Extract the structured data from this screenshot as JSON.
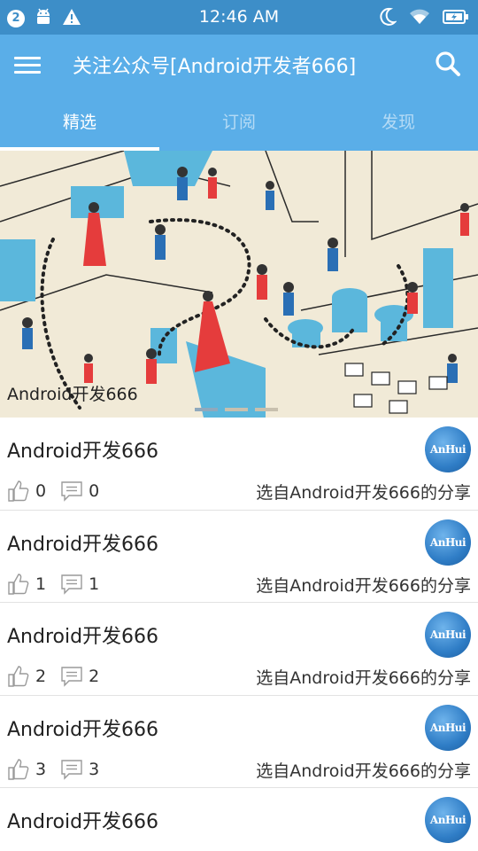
{
  "status_bar": {
    "badge": "2",
    "time": "12:46 AM"
  },
  "app_bar": {
    "title": "关注公众号[Android开发者666]"
  },
  "tabs": [
    {
      "label": "精选",
      "active": true
    },
    {
      "label": "订阅",
      "active": false
    },
    {
      "label": "发现",
      "active": false
    }
  ],
  "banner": {
    "caption": "Android开发666",
    "page_count": 3,
    "current_page": 1
  },
  "list": [
    {
      "title": "Android开发666",
      "avatar_text": "AnHui",
      "likes": "0",
      "comments": "0",
      "source": "选自Android开发666的分享"
    },
    {
      "title": "Android开发666",
      "avatar_text": "AnHui",
      "likes": "1",
      "comments": "1",
      "source": "选自Android开发666的分享"
    },
    {
      "title": "Android开发666",
      "avatar_text": "AnHui",
      "likes": "2",
      "comments": "2",
      "source": "选自Android开发666的分享"
    },
    {
      "title": "Android开发666",
      "avatar_text": "AnHui",
      "likes": "3",
      "comments": "3",
      "source": "选自Android开发666的分享"
    },
    {
      "title": "Android开发666",
      "avatar_text": "AnHui"
    }
  ],
  "colors": {
    "status_bar": "#3d8ec8",
    "app_bar": "#5aaee8",
    "text_dark": "#222222",
    "divider": "#e2e2e2"
  }
}
